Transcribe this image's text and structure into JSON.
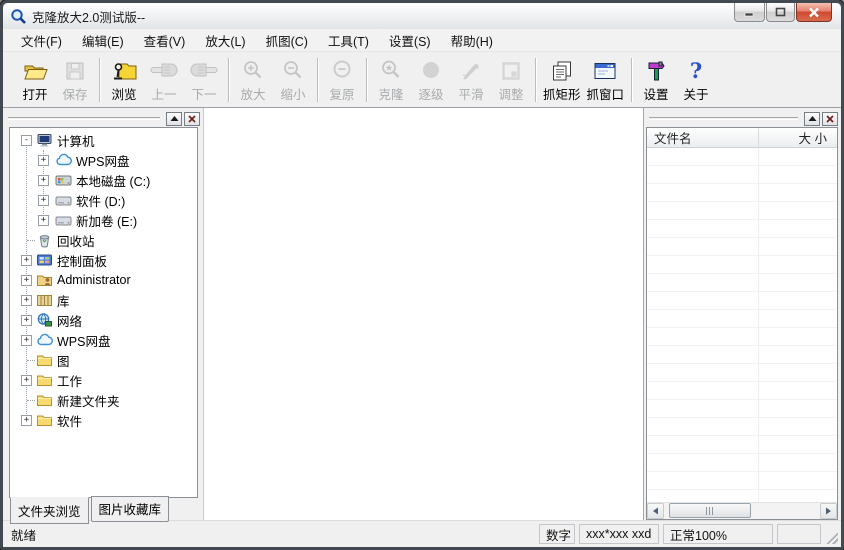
{
  "window": {
    "title": "克隆放大2.0测试版--",
    "app_icon": "app-magnifier-icon",
    "controls": [
      {
        "name": "minimize-button",
        "icon": "minimize-icon"
      },
      {
        "name": "maximize-button",
        "icon": "maximize-icon"
      },
      {
        "name": "close-button",
        "icon": "close-icon"
      }
    ]
  },
  "menu_bar": {
    "items": [
      {
        "name": "menu-file",
        "label": "文件(F)"
      },
      {
        "name": "menu-edit",
        "label": "编辑(E)"
      },
      {
        "name": "menu-view",
        "label": "查看(V)"
      },
      {
        "name": "menu-magnify",
        "label": "放大(L)"
      },
      {
        "name": "menu-capture",
        "label": "抓图(C)"
      },
      {
        "name": "menu-tools",
        "label": "工具(T)"
      },
      {
        "name": "menu-settings",
        "label": "设置(S)"
      },
      {
        "name": "menu-help",
        "label": "帮助(H)"
      }
    ]
  },
  "toolbar": {
    "groups": [
      [
        {
          "name": "open-button",
          "label": "打开",
          "icon": "open-folder-icon",
          "enabled": true
        },
        {
          "name": "save-button",
          "label": "保存",
          "icon": "save-floppy-icon",
          "enabled": false
        }
      ],
      [
        {
          "name": "browse-button",
          "label": "浏览",
          "icon": "browse-folder-icon",
          "enabled": true
        },
        {
          "name": "prev-button",
          "label": "上一",
          "icon": "hand-left-icon",
          "enabled": false
        },
        {
          "name": "next-button",
          "label": "下一",
          "icon": "hand-right-icon",
          "enabled": false
        }
      ],
      [
        {
          "name": "zoom-in-button",
          "label": "放大",
          "icon": "zoom-in-icon",
          "enabled": false
        },
        {
          "name": "zoom-out-button",
          "label": "缩小",
          "icon": "zoom-out-icon",
          "enabled": false
        }
      ],
      [
        {
          "name": "restore-button",
          "label": "复原",
          "icon": "restore-icon",
          "enabled": false
        }
      ],
      [
        {
          "name": "clone-button",
          "label": "克隆",
          "icon": "clone-magnifier-icon",
          "enabled": false
        },
        {
          "name": "step-button",
          "label": "逐级",
          "icon": "step-circle-icon",
          "enabled": false
        },
        {
          "name": "smooth-button",
          "label": "平滑",
          "icon": "smooth-brush-icon",
          "enabled": false
        },
        {
          "name": "adjust-button",
          "label": "调整",
          "icon": "adjust-frame-icon",
          "enabled": false
        }
      ],
      [
        {
          "name": "capture-rect-button",
          "label": "抓矩形",
          "icon": "capture-rect-icon",
          "enabled": true
        },
        {
          "name": "capture-window-button",
          "label": "抓窗口",
          "icon": "capture-window-icon",
          "enabled": true
        }
      ],
      [
        {
          "name": "settings-button",
          "label": "设置",
          "icon": "settings-tools-icon",
          "enabled": true
        },
        {
          "name": "about-button",
          "label": "关于",
          "icon": "about-question-icon",
          "enabled": true
        }
      ]
    ]
  },
  "left_panel": {
    "header_buttons": [
      {
        "name": "panel-collapse-button",
        "icon": "triangle-up-icon"
      },
      {
        "name": "panel-close-button",
        "icon": "small-x-icon"
      }
    ],
    "tree": [
      {
        "label": "计算机",
        "level": 0,
        "expand": "minus",
        "icon": "computer-icon"
      },
      {
        "label": "WPS网盘",
        "level": 1,
        "expand": "plus",
        "icon": "cloud-icon"
      },
      {
        "label": "本地磁盘 (C:)",
        "level": 1,
        "expand": "plus",
        "icon": "system-drive-icon"
      },
      {
        "label": "软件 (D:)",
        "level": 1,
        "expand": "plus",
        "icon": "drive-icon"
      },
      {
        "label": "新加卷 (E:)",
        "level": 1,
        "expand": "plus",
        "icon": "drive-icon"
      },
      {
        "label": "回收站",
        "level": 0,
        "expand": "none",
        "icon": "recycle-bin-icon"
      },
      {
        "label": "控制面板",
        "level": 0,
        "expand": "plus",
        "icon": "control-panel-icon"
      },
      {
        "label": "Administrator",
        "level": 0,
        "expand": "plus",
        "icon": "user-folder-icon"
      },
      {
        "label": "库",
        "level": 0,
        "expand": "plus",
        "icon": "library-icon"
      },
      {
        "label": "网络",
        "level": 0,
        "expand": "plus",
        "icon": "network-icon"
      },
      {
        "label": "WPS网盘",
        "level": 0,
        "expand": "plus",
        "icon": "cloud-icon"
      },
      {
        "label": "图",
        "level": 0,
        "expand": "none",
        "icon": "folder-icon"
      },
      {
        "label": "工作",
        "level": 0,
        "expand": "plus",
        "icon": "folder-icon"
      },
      {
        "label": "新建文件夹",
        "level": 0,
        "expand": "none",
        "icon": "folder-icon"
      },
      {
        "label": "软件",
        "level": 0,
        "expand": "plus",
        "icon": "folder-icon"
      }
    ],
    "tabs": [
      {
        "name": "tab-folder-browse",
        "label": "文件夹浏览",
        "active": true
      },
      {
        "name": "tab-image-collection",
        "label": "图片收藏库",
        "active": false
      }
    ]
  },
  "right_panel": {
    "header_buttons": [
      {
        "name": "panel-collapse-button",
        "icon": "triangle-up-icon"
      },
      {
        "name": "panel-close-button",
        "icon": "small-x-icon"
      }
    ],
    "columns": [
      {
        "name": "column-filename",
        "label": "文件名"
      },
      {
        "name": "column-size",
        "label": "大 小"
      }
    ],
    "rows": []
  },
  "status_bar": {
    "ready_text": "就绪",
    "panes": [
      {
        "name": "numeric-pane",
        "label": "数字"
      },
      {
        "name": "dimensions-pane",
        "label": "xxx*xxx xxd"
      },
      {
        "name": "zoom-pane",
        "label": "正常100%"
      },
      {
        "name": "blank-pane",
        "label": ""
      }
    ]
  },
  "colors": {
    "close_button_red": "#ce4a31",
    "folder_yellow": "#f6d96f",
    "disabled_text": "#a9abad",
    "app_blue": "#1b55b5"
  }
}
